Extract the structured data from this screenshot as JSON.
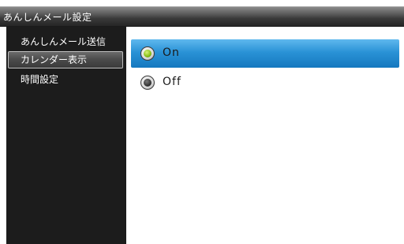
{
  "window": {
    "title": "あんしんメール設定"
  },
  "sidebar": {
    "items": [
      {
        "label": "あんしんメール送信",
        "selected": false
      },
      {
        "label": "カレンダー表示",
        "selected": true
      },
      {
        "label": "時間設定",
        "selected": false
      }
    ]
  },
  "main": {
    "options": [
      {
        "label": "On",
        "checked": true,
        "highlighted": true
      },
      {
        "label": "Off",
        "checked": false,
        "highlighted": false
      }
    ]
  },
  "colors": {
    "highlight": "#2a92d6",
    "sidebar_bg": "#1c1c1c",
    "radio_on": "#8cc21a"
  }
}
